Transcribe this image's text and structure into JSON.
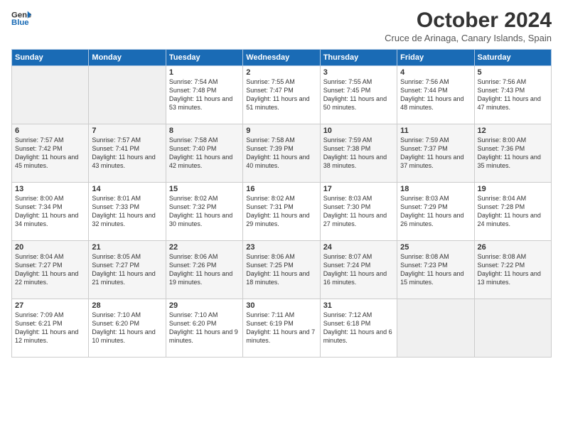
{
  "logo": {
    "line1": "General",
    "line2": "Blue"
  },
  "header": {
    "month": "October 2024",
    "location": "Cruce de Arinaga, Canary Islands, Spain"
  },
  "days": [
    "Sunday",
    "Monday",
    "Tuesday",
    "Wednesday",
    "Thursday",
    "Friday",
    "Saturday"
  ],
  "weeks": [
    [
      {
        "num": "",
        "text": ""
      },
      {
        "num": "",
        "text": ""
      },
      {
        "num": "1",
        "text": "Sunrise: 7:54 AM\nSunset: 7:48 PM\nDaylight: 11 hours and 53 minutes."
      },
      {
        "num": "2",
        "text": "Sunrise: 7:55 AM\nSunset: 7:47 PM\nDaylight: 11 hours and 51 minutes."
      },
      {
        "num": "3",
        "text": "Sunrise: 7:55 AM\nSunset: 7:45 PM\nDaylight: 11 hours and 50 minutes."
      },
      {
        "num": "4",
        "text": "Sunrise: 7:56 AM\nSunset: 7:44 PM\nDaylight: 11 hours and 48 minutes."
      },
      {
        "num": "5",
        "text": "Sunrise: 7:56 AM\nSunset: 7:43 PM\nDaylight: 11 hours and 47 minutes."
      }
    ],
    [
      {
        "num": "6",
        "text": "Sunrise: 7:57 AM\nSunset: 7:42 PM\nDaylight: 11 hours and 45 minutes."
      },
      {
        "num": "7",
        "text": "Sunrise: 7:57 AM\nSunset: 7:41 PM\nDaylight: 11 hours and 43 minutes."
      },
      {
        "num": "8",
        "text": "Sunrise: 7:58 AM\nSunset: 7:40 PM\nDaylight: 11 hours and 42 minutes."
      },
      {
        "num": "9",
        "text": "Sunrise: 7:58 AM\nSunset: 7:39 PM\nDaylight: 11 hours and 40 minutes."
      },
      {
        "num": "10",
        "text": "Sunrise: 7:59 AM\nSunset: 7:38 PM\nDaylight: 11 hours and 38 minutes."
      },
      {
        "num": "11",
        "text": "Sunrise: 7:59 AM\nSunset: 7:37 PM\nDaylight: 11 hours and 37 minutes."
      },
      {
        "num": "12",
        "text": "Sunrise: 8:00 AM\nSunset: 7:36 PM\nDaylight: 11 hours and 35 minutes."
      }
    ],
    [
      {
        "num": "13",
        "text": "Sunrise: 8:00 AM\nSunset: 7:34 PM\nDaylight: 11 hours and 34 minutes."
      },
      {
        "num": "14",
        "text": "Sunrise: 8:01 AM\nSunset: 7:33 PM\nDaylight: 11 hours and 32 minutes."
      },
      {
        "num": "15",
        "text": "Sunrise: 8:02 AM\nSunset: 7:32 PM\nDaylight: 11 hours and 30 minutes."
      },
      {
        "num": "16",
        "text": "Sunrise: 8:02 AM\nSunset: 7:31 PM\nDaylight: 11 hours and 29 minutes."
      },
      {
        "num": "17",
        "text": "Sunrise: 8:03 AM\nSunset: 7:30 PM\nDaylight: 11 hours and 27 minutes."
      },
      {
        "num": "18",
        "text": "Sunrise: 8:03 AM\nSunset: 7:29 PM\nDaylight: 11 hours and 26 minutes."
      },
      {
        "num": "19",
        "text": "Sunrise: 8:04 AM\nSunset: 7:28 PM\nDaylight: 11 hours and 24 minutes."
      }
    ],
    [
      {
        "num": "20",
        "text": "Sunrise: 8:04 AM\nSunset: 7:27 PM\nDaylight: 11 hours and 22 minutes."
      },
      {
        "num": "21",
        "text": "Sunrise: 8:05 AM\nSunset: 7:27 PM\nDaylight: 11 hours and 21 minutes."
      },
      {
        "num": "22",
        "text": "Sunrise: 8:06 AM\nSunset: 7:26 PM\nDaylight: 11 hours and 19 minutes."
      },
      {
        "num": "23",
        "text": "Sunrise: 8:06 AM\nSunset: 7:25 PM\nDaylight: 11 hours and 18 minutes."
      },
      {
        "num": "24",
        "text": "Sunrise: 8:07 AM\nSunset: 7:24 PM\nDaylight: 11 hours and 16 minutes."
      },
      {
        "num": "25",
        "text": "Sunrise: 8:08 AM\nSunset: 7:23 PM\nDaylight: 11 hours and 15 minutes."
      },
      {
        "num": "26",
        "text": "Sunrise: 8:08 AM\nSunset: 7:22 PM\nDaylight: 11 hours and 13 minutes."
      }
    ],
    [
      {
        "num": "27",
        "text": "Sunrise: 7:09 AM\nSunset: 6:21 PM\nDaylight: 11 hours and 12 minutes."
      },
      {
        "num": "28",
        "text": "Sunrise: 7:10 AM\nSunset: 6:20 PM\nDaylight: 11 hours and 10 minutes."
      },
      {
        "num": "29",
        "text": "Sunrise: 7:10 AM\nSunset: 6:20 PM\nDaylight: 11 hours and 9 minutes."
      },
      {
        "num": "30",
        "text": "Sunrise: 7:11 AM\nSunset: 6:19 PM\nDaylight: 11 hours and 7 minutes."
      },
      {
        "num": "31",
        "text": "Sunrise: 7:12 AM\nSunset: 6:18 PM\nDaylight: 11 hours and 6 minutes."
      },
      {
        "num": "",
        "text": ""
      },
      {
        "num": "",
        "text": ""
      }
    ]
  ]
}
